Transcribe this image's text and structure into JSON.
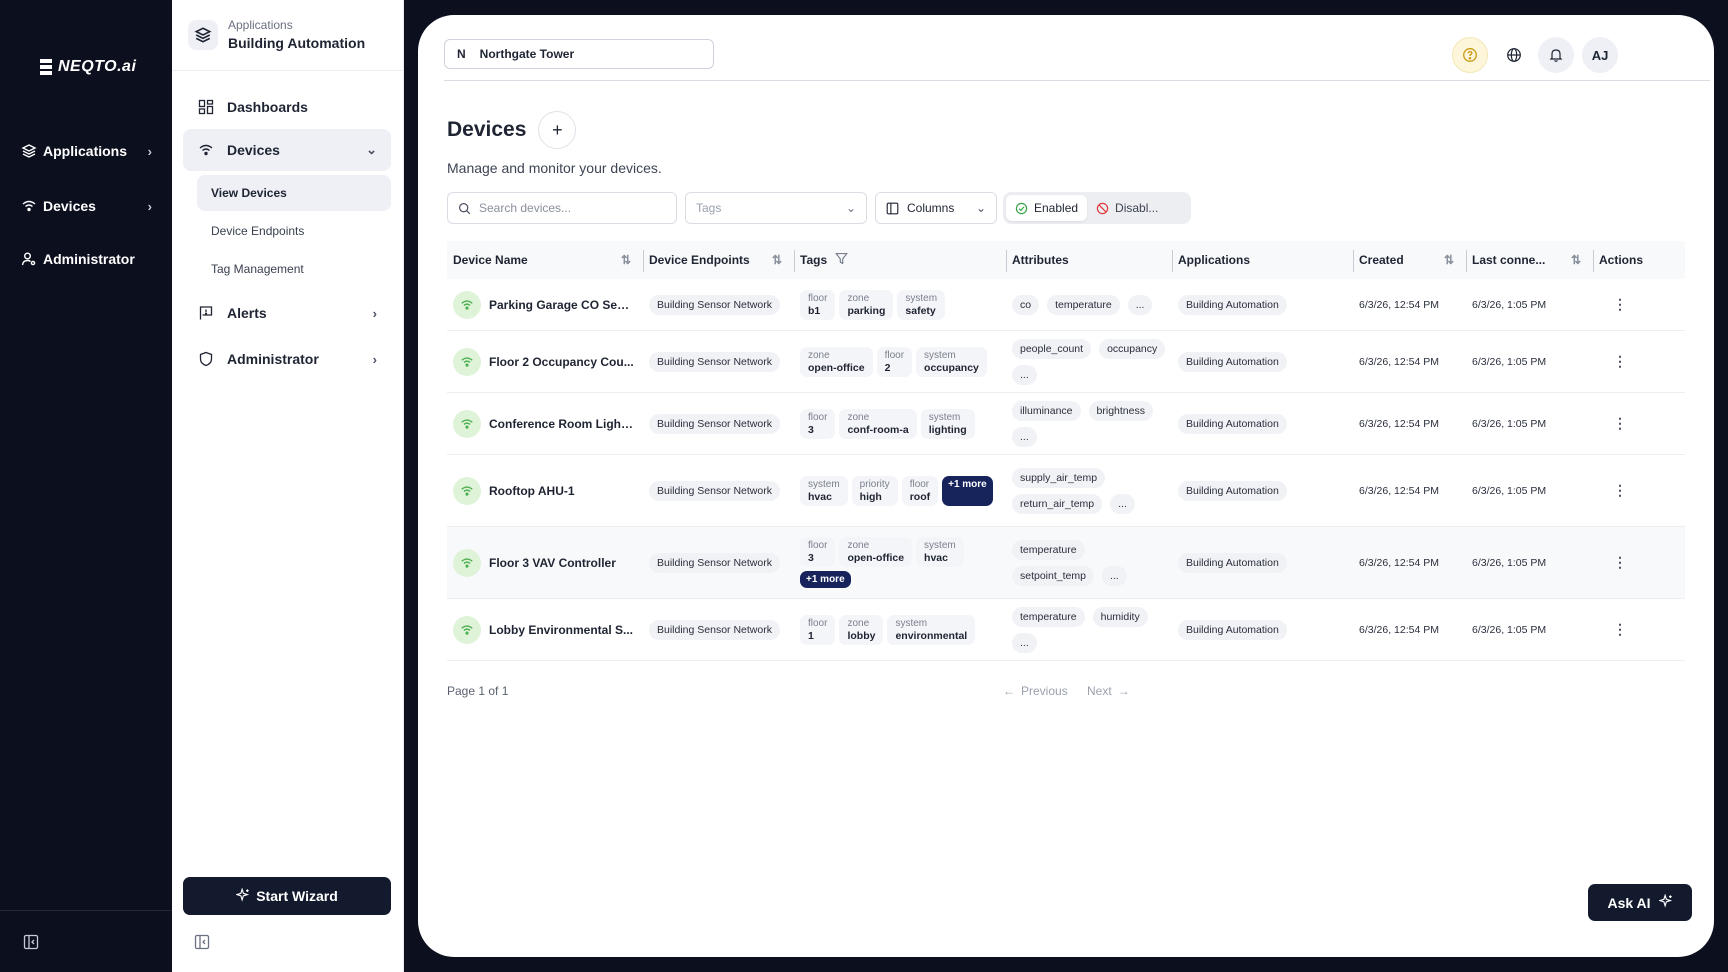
{
  "rail": {
    "logo": "NEQTO.ai",
    "items": [
      {
        "label": "Applications"
      },
      {
        "label": "Devices"
      },
      {
        "label": "Administrator"
      }
    ]
  },
  "sidebar": {
    "app_sub": "Applications",
    "app_title": "Building Automation",
    "nav": {
      "dashboards": "Dashboards",
      "devices": "Devices",
      "alerts": "Alerts",
      "administrator": "Administrator"
    },
    "subnav": {
      "view_devices": "View Devices",
      "device_endpoints": "Device Endpoints",
      "tag_management": "Tag Management"
    },
    "wizard": "Start Wizard"
  },
  "topbar": {
    "project_initial": "N",
    "project_name": "Northgate Tower",
    "avatar": "AJ"
  },
  "page": {
    "title": "Devices",
    "subtitle": "Manage and monitor your devices."
  },
  "filters": {
    "search_placeholder": "Search devices...",
    "tags_placeholder": "Tags",
    "columns": "Columns",
    "enabled": "Enabled",
    "disabled": "Disabl..."
  },
  "table": {
    "headers": {
      "name": "Device Name",
      "endpoints": "Device Endpoints",
      "tags": "Tags",
      "attributes": "Attributes",
      "applications": "Applications",
      "created": "Created",
      "last": "Last conne...",
      "actions": "Actions"
    },
    "rows": [
      {
        "name": "Parking Garage CO Sen...",
        "endpoint": "Building Sensor Network",
        "tags": [
          {
            "k": "floor",
            "v": "b1"
          },
          {
            "k": "zone",
            "v": "parking"
          },
          {
            "k": "system",
            "v": "safety"
          }
        ],
        "more": "",
        "attributes": [
          "co",
          "temperature",
          "..."
        ],
        "application": "Building Automation",
        "created": "6/3/26, 12:54 PM",
        "last": "6/3/26, 1:05 PM"
      },
      {
        "name": "Floor 2 Occupancy Cou...",
        "endpoint": "Building Sensor Network",
        "tags": [
          {
            "k": "zone",
            "v": "open-office"
          },
          {
            "k": "floor",
            "v": "2"
          },
          {
            "k": "system",
            "v": "occupancy"
          }
        ],
        "more": "",
        "attributes": [
          "people_count",
          "occupancy",
          "..."
        ],
        "application": "Building Automation",
        "created": "6/3/26, 12:54 PM",
        "last": "6/3/26, 1:05 PM"
      },
      {
        "name": "Conference Room Light...",
        "endpoint": "Building Sensor Network",
        "tags": [
          {
            "k": "floor",
            "v": "3"
          },
          {
            "k": "zone",
            "v": "conf-room-a"
          },
          {
            "k": "system",
            "v": "lighting"
          }
        ],
        "more": "",
        "attributes": [
          "illuminance",
          "brightness",
          "..."
        ],
        "application": "Building Automation",
        "created": "6/3/26, 12:54 PM",
        "last": "6/3/26, 1:05 PM"
      },
      {
        "name": "Rooftop AHU-1",
        "endpoint": "Building Sensor Network",
        "tags": [
          {
            "k": "system",
            "v": "hvac"
          },
          {
            "k": "priority",
            "v": "high"
          },
          {
            "k": "floor",
            "v": "roof"
          }
        ],
        "more": "+1 more",
        "attributes": [
          "supply_air_temp",
          "return_air_temp",
          "..."
        ],
        "application": "Building Automation",
        "created": "6/3/26, 12:54 PM",
        "last": "6/3/26, 1:05 PM"
      },
      {
        "name": "Floor 3 VAV Controller",
        "endpoint": "Building Sensor Network",
        "tags": [
          {
            "k": "floor",
            "v": "3"
          },
          {
            "k": "zone",
            "v": "open-office"
          },
          {
            "k": "system",
            "v": "hvac"
          }
        ],
        "more": "+1 more",
        "attributes": [
          "temperature",
          "setpoint_temp",
          "..."
        ],
        "application": "Building Automation",
        "created": "6/3/26, 12:54 PM",
        "last": "6/3/26, 1:05 PM"
      },
      {
        "name": "Lobby Environmental S...",
        "endpoint": "Building Sensor Network",
        "tags": [
          {
            "k": "floor",
            "v": "1"
          },
          {
            "k": "zone",
            "v": "lobby"
          },
          {
            "k": "system",
            "v": "environmental"
          }
        ],
        "more": "",
        "attributes": [
          "temperature",
          "humidity",
          "..."
        ],
        "application": "Building Automation",
        "created": "6/3/26, 12:54 PM",
        "last": "6/3/26, 1:05 PM"
      }
    ]
  },
  "pager": {
    "info": "Page 1 of 1",
    "previous": "Previous",
    "next": "Next"
  },
  "ask_ai": "Ask AI",
  "colors": {
    "rail_bg": "#0b0f1e",
    "dark_button": "#141a2e",
    "more_badge": "#17245c",
    "status_ok": "#4caf50"
  }
}
